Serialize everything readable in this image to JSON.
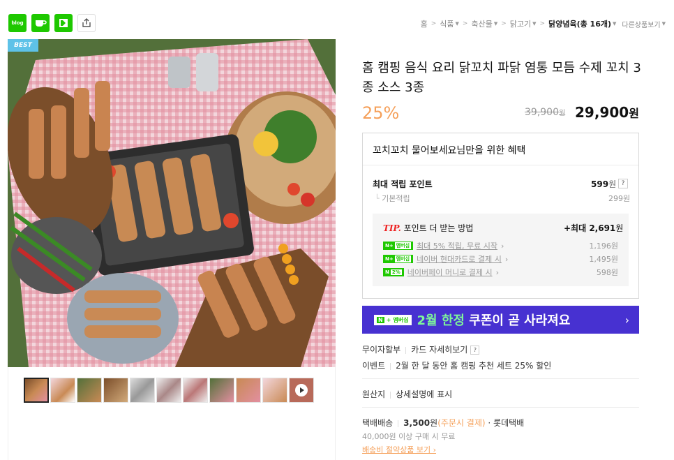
{
  "share": {
    "icons": [
      "blog-icon",
      "cafe-icon",
      "band-icon",
      "share-icon"
    ],
    "blog_label": "blog"
  },
  "breadcrumb": {
    "items": [
      "홈",
      "식품",
      "축산물",
      "닭고기"
    ],
    "current": "닭양념육",
    "count": "(총 16개)",
    "other": "다른상품보기"
  },
  "product": {
    "badge": "BEST",
    "title": "홈 캠핑 음식 요리 닭꼬치 파닭 염통 모듬 수제 꼬치 3종 소스 3종",
    "discount": "25%",
    "original_price": "39,900",
    "original_unit": "원",
    "sale_price": "29,900",
    "sale_unit": "원"
  },
  "benefit": {
    "title": "꼬치꼬치 물어보세요님만을 위한 혜택",
    "max_point_label": "최대 적립 포인트",
    "max_point_value": "599",
    "point_unit": "원",
    "help": "?",
    "base_label": "기본적립",
    "base_value": "299원",
    "tip_label": "TIP.",
    "tip_text": "포인트 더 받는 방법",
    "tip_max_prefix": "+최대",
    "tip_max_value": "2,691",
    "tip_rows": [
      {
        "text": "최대 5% 적립, 무료 시작",
        "value": "1,196원"
      },
      {
        "text": "네이버 현대카드로 결제 시",
        "value": "1,495원"
      },
      {
        "text": "네이버페이 머니로 결제 시",
        "value": "598원"
      }
    ],
    "npay_label": "N",
    "membership_label": "멤버십",
    "percent_label": "2%"
  },
  "banner": {
    "badge_n": "N",
    "badge_text": "멤버십",
    "text_highlight": "2월 한정",
    "text_rest": " 쿠폰이 곧 사라져요",
    "arrow": "›"
  },
  "info": {
    "installment_label": "무이자할부",
    "card_link": "카드 자세히보기",
    "event_label": "이벤트",
    "event_text": "2월 한 달 동안 홈 캠핑 추천 세트 25% 할인",
    "origin_label": "원산지",
    "origin_text": "상세설명에 표시",
    "ship_label": "택배배송",
    "ship_price": "3,500",
    "ship_unit": "원",
    "ship_note": "(주문시 결제)",
    "ship_company": "· 롯데택배",
    "ship_free": "40,000원 이상 구매 시 무료",
    "ship_link": "배송비 절약상품 보기 ›"
  },
  "colors": {
    "npay_green": "#1ec800",
    "discount": "#f5a05a",
    "banner": "#4731d1",
    "best": "#5ec2e8"
  }
}
